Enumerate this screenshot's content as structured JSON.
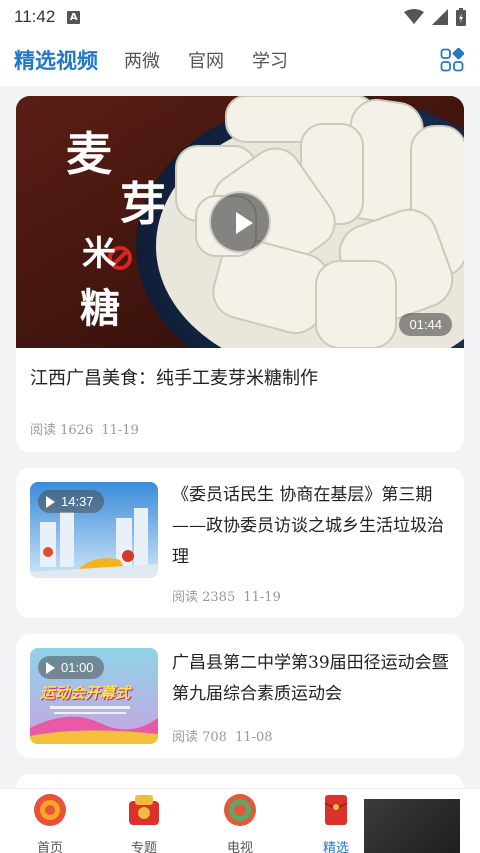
{
  "status_bar": {
    "time": "11:42",
    "notification_icon": "A"
  },
  "top_nav": {
    "tabs": [
      {
        "label": "精选视频",
        "active": true
      },
      {
        "label": "两微",
        "active": false
      },
      {
        "label": "官网",
        "active": false
      },
      {
        "label": "学习",
        "active": false
      }
    ],
    "grid_icon": "apps-grid-icon"
  },
  "featured": {
    "title": "江西广昌美食：纯手工麦芽米糖制作",
    "duration": "01:44",
    "reads": "阅读 1626",
    "date": "11-19",
    "overlay_text": {
      "line1a": "麦",
      "line1b": "芽",
      "line2": "米",
      "line3": "糖"
    }
  },
  "list": [
    {
      "title": "《委员话民生 协商在基层》第三期——政协委员访谈之城乡生活垃圾治理",
      "duration": "14:37",
      "reads": "阅读 2385",
      "date": "11-19"
    },
    {
      "title": "广昌县第二中学第39届田径运动会暨第九届综合素质运动会",
      "duration": "01:00",
      "reads": "阅读 708",
      "date": "11-08",
      "thumb_text": "运动会开幕式"
    }
  ],
  "bottom_nav": [
    {
      "label": "首页",
      "active": false
    },
    {
      "label": "专题",
      "active": false
    },
    {
      "label": "电视",
      "active": false
    },
    {
      "label": "精选",
      "active": true
    }
  ],
  "colors": {
    "accent": "#1f78c8",
    "background": "#f2f3f5"
  }
}
